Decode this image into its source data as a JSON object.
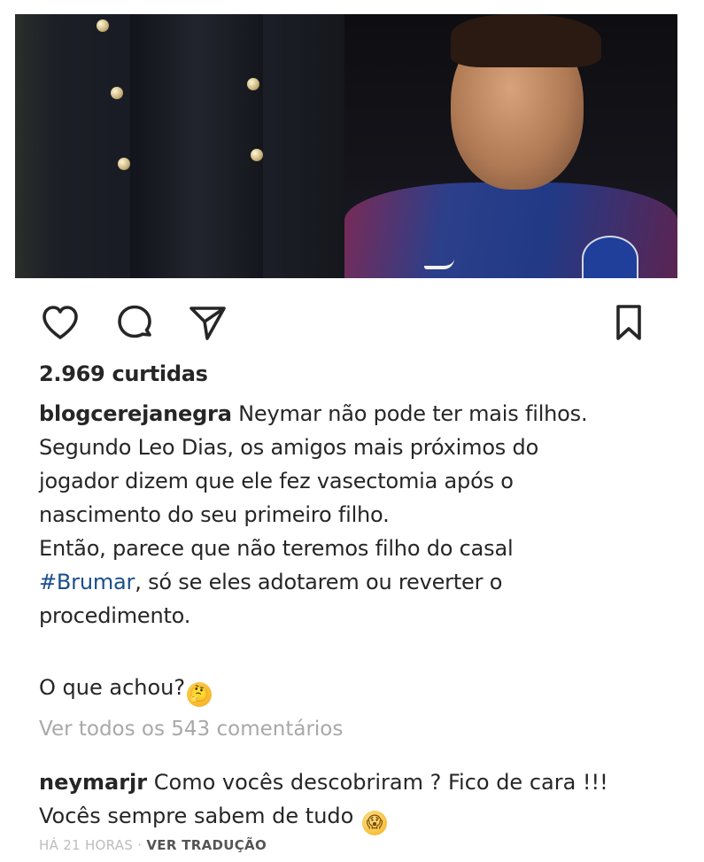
{
  "post": {
    "likes_text": "2.969 curtidas",
    "caption": {
      "username": "blogcerejanegra",
      "line1": "Neymar não pode ter mais filhos.",
      "line2": "Segundo Leo Dias, os amigos mais próximos do",
      "line3": "jogador dizem que ele fez vasectomia após o",
      "line4": "nascimento do seu primeiro filho.",
      "line5": "Então, parece que não teremos filho do casal",
      "hashtag": "#Brumar",
      "line6_rest": ", só se eles adotarem ou reverter o",
      "line7": "procedimento.",
      "question": "O que achou?",
      "question_emoji": "🤔"
    },
    "view_comments": "Ver todos os 543 comentários",
    "comment": {
      "username": "neymarjr",
      "line1": "Como vocês descobriram ? Fico de cara !!!",
      "line2": "Vocês sempre sabem de tudo",
      "emoji": "😱"
    },
    "meta": {
      "time": "HÁ 21 HORAS",
      "separator": " · ",
      "translate": "VER TRADUÇÃO"
    }
  },
  "icons": {
    "like": "heart-icon",
    "comment": "comment-icon",
    "share": "send-icon",
    "save": "bookmark-icon"
  },
  "colors": {
    "text": "#262626",
    "muted": "#a8a8a8",
    "hashtag": "#1a4f8a"
  }
}
